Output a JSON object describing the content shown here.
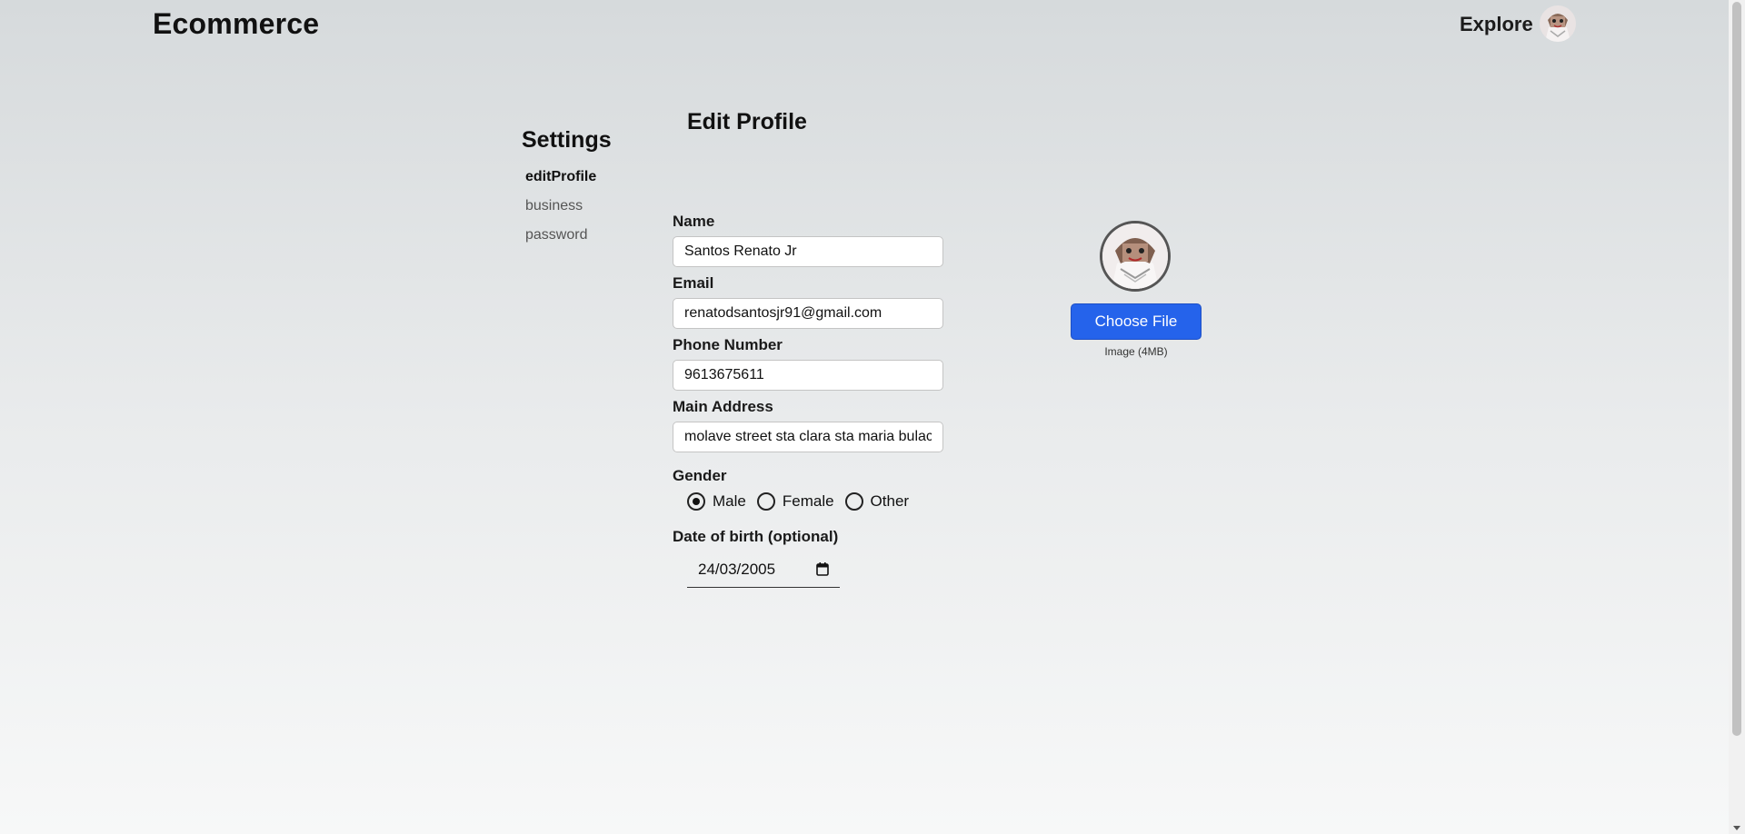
{
  "header": {
    "brand": "Ecommerce",
    "explore_label": "Explore",
    "avatar_icon": "user-avatar-icon"
  },
  "sidebar": {
    "title": "Settings",
    "items": [
      {
        "label": "editProfile",
        "active": true
      },
      {
        "label": "business",
        "active": false
      },
      {
        "label": "password",
        "active": false
      }
    ]
  },
  "main": {
    "title": "Edit Profile",
    "fields": {
      "name": {
        "label": "Name",
        "value": "Santos Renato Jr"
      },
      "email": {
        "label": "Email",
        "value": "renatodsantosjr91@gmail.com"
      },
      "phone": {
        "label": "Phone Number",
        "value": "9613675611"
      },
      "address": {
        "label": "Main Address",
        "value": "molave street sta clara sta maria bulacan"
      }
    },
    "gender": {
      "label": "Gender",
      "options": [
        "Male",
        "Female",
        "Other"
      ],
      "selected": "Male"
    },
    "dob": {
      "label": "Date of birth (optional)",
      "value": "24/03/2005"
    }
  },
  "avatar_panel": {
    "button_label": "Choose File",
    "hint": "Image (4MB)",
    "accent": "#2563eb"
  }
}
